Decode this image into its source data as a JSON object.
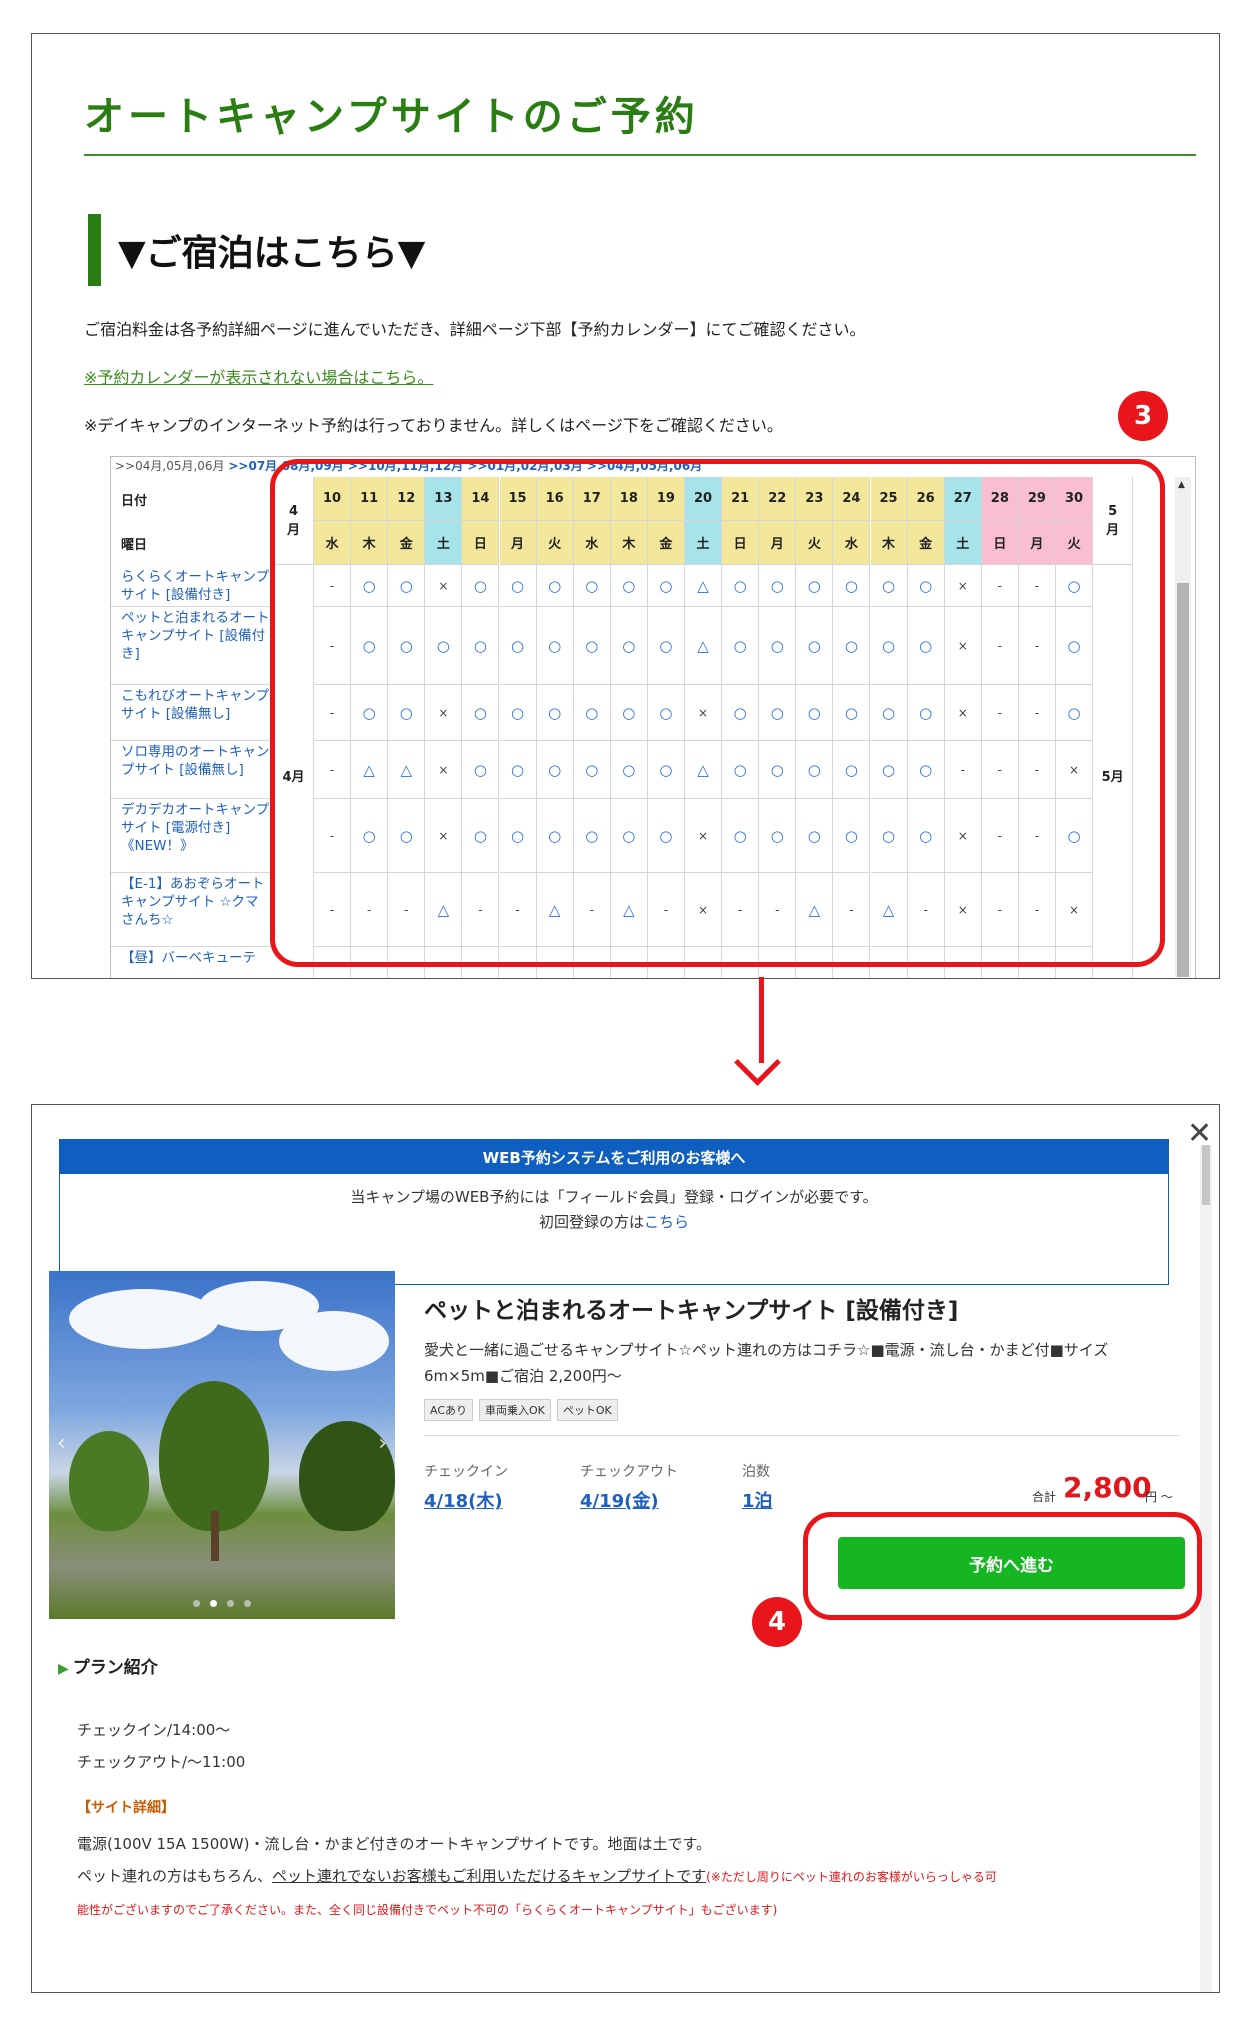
{
  "panel1": {
    "title": "オートキャンプサイトのご予約",
    "subtitle": "▼ご宿泊はこちら▼",
    "info_text": "ご宿泊料金は各予約詳細ページに進んでいただき、詳細ページ下部【予約カレンダー】にてご確認ください。",
    "calendar_link": "※予約カレンダーが表示されない場合はこちら。",
    "day_camp_note": "※デイキャンプのインターネット予約は行っておりません。詳しくはページ下をご確認ください。",
    "calendar": {
      "month_nav_plain": ">>04月,05月,06月 ",
      "month_nav_links": ">>07月,08月,09月 >>10月,11月,12月 >>01月,02月,03月 >>04月,05月,06月",
      "header_date": "日付",
      "header_weekday": "曜日",
      "month_start": "4\n月",
      "month_end": "5\n月",
      "month_label_left": "4月",
      "month_label_right": "5月",
      "days": [
        "10",
        "11",
        "12",
        "13",
        "14",
        "15",
        "16",
        "17",
        "18",
        "19",
        "20",
        "21",
        "22",
        "23",
        "24",
        "25",
        "26",
        "27",
        "28",
        "29",
        "30"
      ],
      "weekdays": [
        "水",
        "木",
        "金",
        "土",
        "日",
        "月",
        "火",
        "水",
        "木",
        "金",
        "土",
        "日",
        "月",
        "火",
        "水",
        "木",
        "金",
        "土",
        "日",
        "月",
        "火"
      ],
      "rows": [
        {
          "site": "らくらくオートキャンプサイト [設備付き]",
          "cells": [
            "-",
            "○",
            "○",
            "×",
            "○",
            "○",
            "○",
            "○",
            "○",
            "○",
            "△",
            "○",
            "○",
            "○",
            "○",
            "○",
            "○",
            "×",
            "-",
            "-",
            "○"
          ]
        },
        {
          "site": "ペットと泊まれるオートキャンプサイト [設備付き]",
          "cells": [
            "-",
            "○",
            "○",
            "○",
            "○",
            "○",
            "○",
            "○",
            "○",
            "○",
            "△",
            "○",
            "○",
            "○",
            "○",
            "○",
            "○",
            "×",
            "-",
            "-",
            "○"
          ]
        },
        {
          "site": "こもれびオートキャンプサイト [設備無し]",
          "cells": [
            "-",
            "○",
            "○",
            "×",
            "○",
            "○",
            "○",
            "○",
            "○",
            "○",
            "×",
            "○",
            "○",
            "○",
            "○",
            "○",
            "○",
            "×",
            "-",
            "-",
            "○"
          ]
        },
        {
          "site": "ソロ専用のオートキャンプサイト [設備無し]",
          "cells": [
            "-",
            "△",
            "△",
            "×",
            "○",
            "○",
            "○",
            "○",
            "○",
            "○",
            "△",
            "○",
            "○",
            "○",
            "○",
            "○",
            "○",
            "-",
            "-",
            "-",
            "×"
          ]
        },
        {
          "site": "デカデカオートキャンプサイト [電源付き]《NEW！》",
          "cells": [
            "-",
            "○",
            "○",
            "×",
            "○",
            "○",
            "○",
            "○",
            "○",
            "○",
            "×",
            "○",
            "○",
            "○",
            "○",
            "○",
            "○",
            "×",
            "-",
            "-",
            "○"
          ]
        },
        {
          "site": "【E-1】あおぞらオートキャンプサイト ☆クマさんち☆",
          "cells": [
            "-",
            "-",
            "-",
            "△",
            "-",
            "-",
            "△",
            "-",
            "△",
            "-",
            "×",
            "-",
            "-",
            "△",
            "-",
            "△",
            "-",
            "×",
            "-",
            "-",
            "×"
          ]
        },
        {
          "site": "【昼】バーベキューテ",
          "cells": []
        }
      ]
    }
  },
  "badge3": "3",
  "badge4": "4",
  "panel2": {
    "close_label": "✕",
    "notice_title": "WEB予約システムをご利用のお客様へ",
    "notice_line1": "当キャンプ場のWEB予約には「フィールド会員」登録・ログインが必要です。",
    "notice_line2_prefix": "初回登録の方は",
    "notice_link": "こちら",
    "plan_title": "ペットと泊まれるオートキャンプサイト [設備付き]",
    "plan_description": "愛犬と一緒に過ごせるキャンプサイト☆ペット連れの方はコチラ☆■電源・流し台・かまど付■サイズ6m×5m■ご宿泊 2,200円～",
    "tags": [
      "ACあり",
      "車両乗入OK",
      "ペットOK"
    ],
    "checkin_label": "チェックイン",
    "checkin_value": "4/18(木)",
    "checkout_label": "チェックアウト",
    "checkout_value": "4/19(金)",
    "nights_label": "泊数",
    "nights_value": "1泊",
    "price_prefix": "合計",
    "price_value": "2,800",
    "price_suffix": "円 ～",
    "reserve_button": "予約へ進む",
    "section_title": "プラン紹介",
    "checkin_time": "チェックイン/14:00～",
    "checkout_time": "チェックアウト/～11:00",
    "site_detail_heading": "【サイト詳細】",
    "detail_line1": "電源(100V 15A 1500W)・流し台・かまど付きのオートキャンプサイトです。地面は土です。",
    "detail_line2_prefix": "ペット連れの方はもちろん、",
    "detail_line2_underlined": "ペット連れでないお客様もご利用いただけるキャンプサイトです",
    "detail_line2_red": "(※ただし周りにペット連れのお客様がいらっしゃる可",
    "detail_line3_red": "能性がございますのでご了承ください。また、全く同じ設備付きでペット不可の「らくらくオートキャンプサイト」もございます)"
  },
  "colors": {
    "title_green": "#2a7d12",
    "highlight_red": "#e8161b",
    "link_blue": "#1f5fbf",
    "button_green": "#16b622",
    "notice_blue": "#0e5fc0"
  }
}
